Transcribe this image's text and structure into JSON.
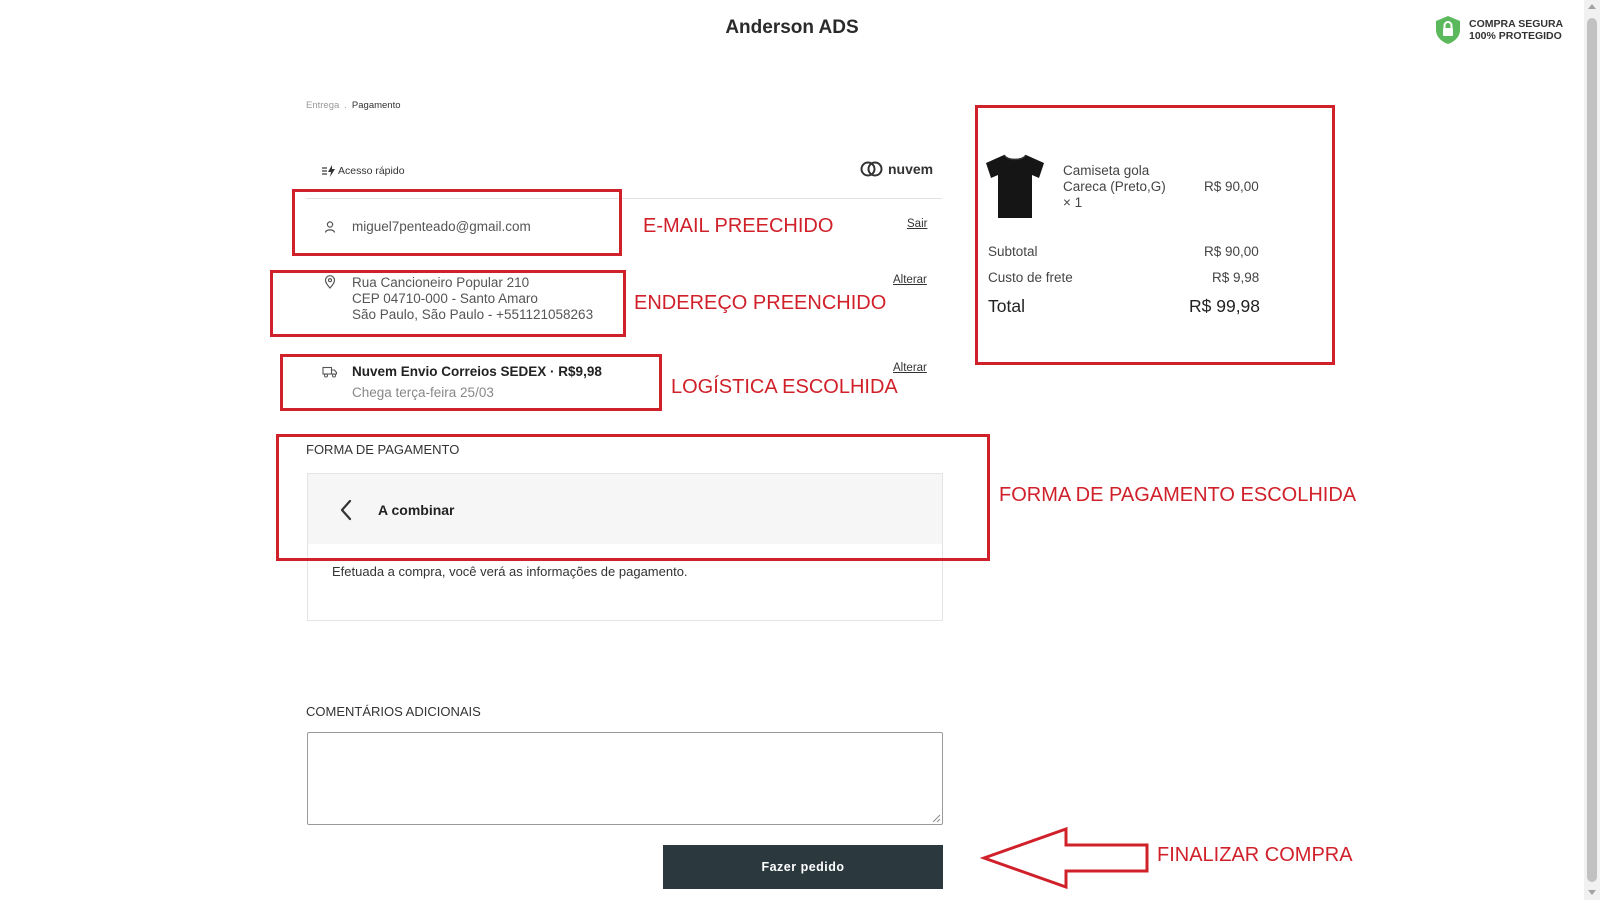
{
  "header": {
    "store_name": "Anderson ADS",
    "secure_line1": "COMPRA SEGURA",
    "secure_line2": "100% PROTEGIDO"
  },
  "breadcrumb": {
    "step1": "Entrega",
    "separator": ".",
    "step2": "Pagamento"
  },
  "quick_access": {
    "label": "Acesso rápido",
    "brand": "nuvem"
  },
  "contact": {
    "email": "miguel7penteado@gmail.com",
    "logout_label": "Sair"
  },
  "address": {
    "line1": "Rua Cancioneiro Popular 210",
    "line2": "CEP 04710-000 - Santo Amaro",
    "line3": "São Paulo, São Paulo - +551121058263",
    "change_label": "Alterar"
  },
  "shipping": {
    "method": "Nuvem Envio Correios SEDEX · R$9,98",
    "eta": "Chega terça-feira 25/03",
    "change_label": "Alterar"
  },
  "payment": {
    "section_title": "FORMA DE PAGAMENTO",
    "method": "A combinar",
    "description": "Efetuada a compra, você verá as informações de pagamento."
  },
  "comments": {
    "label": "COMENTÁRIOS ADICIONAIS",
    "value": ""
  },
  "submit_label": "Fazer pedido",
  "order_summary": {
    "product_name_line1": "Camiseta gola",
    "product_name_line2": "Careca (Preto,G)",
    "product_qty": "× 1",
    "product_price": "R$ 90,00",
    "subtotal_label": "Subtotal",
    "subtotal_value": "R$ 90,00",
    "shipping_label": "Custo de frete",
    "shipping_value": "R$ 9,98",
    "total_label": "Total",
    "total_value": "R$ 99,98"
  },
  "annotations": {
    "email": "E-MAIL PREECHIDO",
    "address": "ENDEREÇO PREENCHIDO",
    "logistics": "LOGÍSTICA ESCOLHIDA",
    "payment": "FORMA DE PAGAMENTO ESCOLHIDA",
    "finalize": "FINALIZAR COMPRA"
  },
  "colors": {
    "annotation_red": "#d0202a",
    "button_dark": "#2b383e",
    "secure_green": "#5cb85c"
  }
}
